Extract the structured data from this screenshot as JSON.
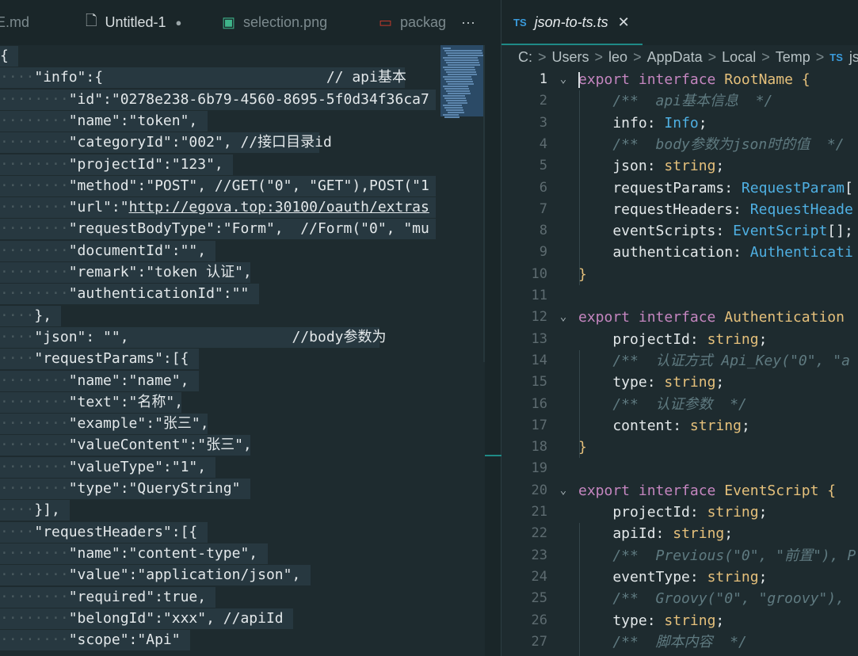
{
  "left_tabs": [
    {
      "label": "ME.md",
      "icon": "markdown-file-icon"
    },
    {
      "label": "Untitled-1",
      "icon": "file-icon",
      "dirty": true
    },
    {
      "label": "selection.png",
      "icon": "image-icon"
    },
    {
      "label": "packag",
      "icon": "npm-icon"
    }
  ],
  "more_actions": "···",
  "right_tab": {
    "badge": "TS",
    "label": "json-to-ts.ts",
    "close": "✕"
  },
  "breadcrumb": [
    "C:",
    "Users",
    "leo",
    "AppData",
    "Local",
    "Temp"
  ],
  "breadcrumb_file_badge": "TS",
  "breadcrumb_file": "js",
  "left_lines": [
    {
      "indent": 0,
      "text": "{"
    },
    {
      "indent": 1,
      "text": "\"info\":{                          // api基本"
    },
    {
      "indent": 2,
      "text": "\"id\":\"0278e238-6b79-4560-8695-5f0d34f36ca7"
    },
    {
      "indent": 2,
      "text": "\"name\":\"token\","
    },
    {
      "indent": 2,
      "text": "\"categoryId\":\"002\", //接口目录id"
    },
    {
      "indent": 2,
      "text": "\"projectId\":\"123\","
    },
    {
      "indent": 2,
      "text": "\"method\":\"POST\", //GET(\"0\", \"GET\"),POST(\"1"
    },
    {
      "indent": 2,
      "text": "\"url\":\"",
      "link": "http://egova.top:30100/oauth/extras"
    },
    {
      "indent": 2,
      "text": "\"requestBodyType\":\"Form\",  //Form(\"0\", \"mu"
    },
    {
      "indent": 2,
      "text": "\"documentId\":\"\","
    },
    {
      "indent": 2,
      "text": "\"remark\":\"token 认证\","
    },
    {
      "indent": 2,
      "text": "\"authenticationId\":\"\""
    },
    {
      "indent": 1,
      "text": "},"
    },
    {
      "indent": 1,
      "text": "\"json\": \"\",                   //body参数为"
    },
    {
      "indent": 1,
      "text": "\"requestParams\":[{"
    },
    {
      "indent": 2,
      "text": "\"name\":\"name\","
    },
    {
      "indent": 2,
      "text": "\"text\":\"名称\","
    },
    {
      "indent": 2,
      "text": "\"example\":\"张三\","
    },
    {
      "indent": 2,
      "text": "\"valueContent\":\"张三\","
    },
    {
      "indent": 2,
      "text": "\"valueType\":\"1\","
    },
    {
      "indent": 2,
      "text": "\"type\":\"QueryString\""
    },
    {
      "indent": 1,
      "text": "}],"
    },
    {
      "indent": 1,
      "text": "\"requestHeaders\":[{"
    },
    {
      "indent": 2,
      "text": "\"name\":\"content-type\","
    },
    {
      "indent": 2,
      "text": "\"value\":\"application/json\","
    },
    {
      "indent": 2,
      "text": "\"required\":true,"
    },
    {
      "indent": 2,
      "text": "\"belongId\":\"xxx\", //apiId"
    },
    {
      "indent": 2,
      "text": "\"scope\":\"Api\""
    }
  ],
  "right_lines": [
    {
      "n": "1",
      "fold": "⌄",
      "tokens": [
        [
          "kw",
          "export "
        ],
        [
          "kw",
          "interface "
        ],
        [
          "ty",
          "RootName "
        ],
        [
          "br",
          "{"
        ]
      ]
    },
    {
      "n": "2",
      "tokens": [
        [
          "cm",
          "    /**  api基本信息  */"
        ]
      ]
    },
    {
      "n": "3",
      "tokens": [
        [
          "pl",
          "    info"
        ],
        [
          "pl",
          ": "
        ],
        [
          "ty2",
          "Info"
        ],
        [
          "pl",
          ";"
        ]
      ]
    },
    {
      "n": "4",
      "tokens": [
        [
          "cm",
          "    /**  body参数为json时的值  */"
        ]
      ]
    },
    {
      "n": "5",
      "tokens": [
        [
          "pl",
          "    json"
        ],
        [
          "pl",
          ": "
        ],
        [
          "str",
          "string"
        ],
        [
          "pl",
          ";"
        ]
      ]
    },
    {
      "n": "6",
      "tokens": [
        [
          "pl",
          "    requestParams"
        ],
        [
          "pl",
          ": "
        ],
        [
          "ty2",
          "RequestParam"
        ],
        [
          "pl",
          "["
        ]
      ]
    },
    {
      "n": "7",
      "tokens": [
        [
          "pl",
          "    requestHeaders"
        ],
        [
          "pl",
          ": "
        ],
        [
          "ty2",
          "RequestHeade"
        ]
      ]
    },
    {
      "n": "8",
      "tokens": [
        [
          "pl",
          "    eventScripts"
        ],
        [
          "pl",
          ": "
        ],
        [
          "ty2",
          "EventScript"
        ],
        [
          "pl",
          "[];"
        ]
      ]
    },
    {
      "n": "9",
      "tokens": [
        [
          "pl",
          "    authentication"
        ],
        [
          "pl",
          ": "
        ],
        [
          "ty2",
          "Authenticati"
        ]
      ]
    },
    {
      "n": "10",
      "tokens": [
        [
          "br",
          "}"
        ]
      ]
    },
    {
      "n": "11",
      "tokens": []
    },
    {
      "n": "12",
      "fold": "⌄",
      "tokens": [
        [
          "kw",
          "export "
        ],
        [
          "kw",
          "interface "
        ],
        [
          "ty",
          "Authentication "
        ]
      ]
    },
    {
      "n": "13",
      "tokens": [
        [
          "pl",
          "    projectId"
        ],
        [
          "pl",
          ": "
        ],
        [
          "str",
          "string"
        ],
        [
          "pl",
          ";"
        ]
      ]
    },
    {
      "n": "14",
      "tokens": [
        [
          "cm",
          "    /**  认证方式 Api_Key(\"0\", \"a"
        ]
      ]
    },
    {
      "n": "15",
      "tokens": [
        [
          "pl",
          "    type"
        ],
        [
          "pl",
          ": "
        ],
        [
          "str",
          "string"
        ],
        [
          "pl",
          ";"
        ]
      ]
    },
    {
      "n": "16",
      "tokens": [
        [
          "cm",
          "    /**  认证参数  */"
        ]
      ]
    },
    {
      "n": "17",
      "tokens": [
        [
          "pl",
          "    content"
        ],
        [
          "pl",
          ": "
        ],
        [
          "str",
          "string"
        ],
        [
          "pl",
          ";"
        ]
      ]
    },
    {
      "n": "18",
      "tokens": [
        [
          "br",
          "}"
        ]
      ]
    },
    {
      "n": "19",
      "tokens": []
    },
    {
      "n": "20",
      "fold": "⌄",
      "tokens": [
        [
          "kw",
          "export "
        ],
        [
          "kw",
          "interface "
        ],
        [
          "ty",
          "EventScript "
        ],
        [
          "br",
          "{"
        ]
      ]
    },
    {
      "n": "21",
      "tokens": [
        [
          "pl",
          "    projectId"
        ],
        [
          "pl",
          ": "
        ],
        [
          "str",
          "string"
        ],
        [
          "pl",
          ";"
        ]
      ]
    },
    {
      "n": "22",
      "tokens": [
        [
          "pl",
          "    apiId"
        ],
        [
          "pl",
          ": "
        ],
        [
          "str",
          "string"
        ],
        [
          "pl",
          ";"
        ]
      ]
    },
    {
      "n": "23",
      "tokens": [
        [
          "cm",
          "    /**  Previous(\"0\", \"前置\"), P"
        ]
      ]
    },
    {
      "n": "24",
      "tokens": [
        [
          "pl",
          "    eventType"
        ],
        [
          "pl",
          ": "
        ],
        [
          "str",
          "string"
        ],
        [
          "pl",
          ";"
        ]
      ]
    },
    {
      "n": "25",
      "tokens": [
        [
          "cm",
          "    /**  Groovy(\"0\", \"groovy\"), "
        ]
      ]
    },
    {
      "n": "26",
      "tokens": [
        [
          "pl",
          "    type"
        ],
        [
          "pl",
          ": "
        ],
        [
          "str",
          "string"
        ],
        [
          "pl",
          ";"
        ]
      ]
    },
    {
      "n": "27",
      "tokens": [
        [
          "cm",
          "    /**  脚本内容  */"
        ]
      ]
    }
  ]
}
